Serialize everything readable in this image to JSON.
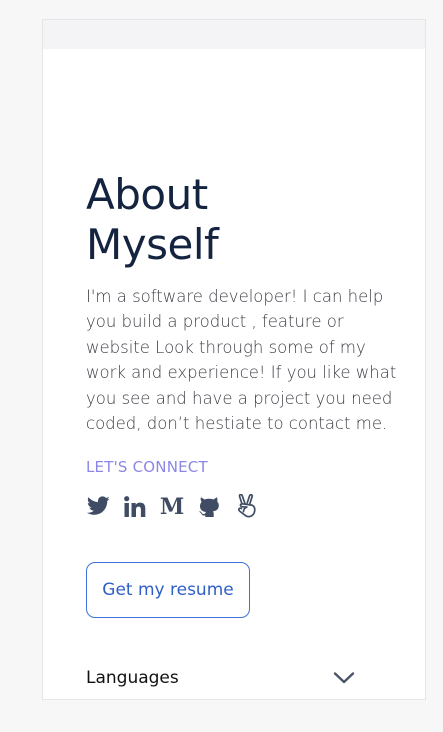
{
  "about": {
    "title_line1": "About",
    "title_line2": "Myself",
    "bio": "I'm a software developer! I can help you build a product , feature or website Look through some of my work and experience! If you like what you see and have a project you need coded, don’t hestiate to contact me."
  },
  "connect": {
    "label": "LET'S CONNECT",
    "icons": [
      "twitter-icon",
      "linkedin-icon",
      "medium-icon",
      "github-icon",
      "angellist-icon"
    ]
  },
  "resume": {
    "button_label": "Get my resume"
  },
  "accordion": {
    "label": "Languages",
    "icon": "chevron-down-icon"
  },
  "colors": {
    "title": "#14233f",
    "accent": "#8c87e6",
    "button_border": "#3d73d8",
    "icon": "#3f4c63"
  }
}
